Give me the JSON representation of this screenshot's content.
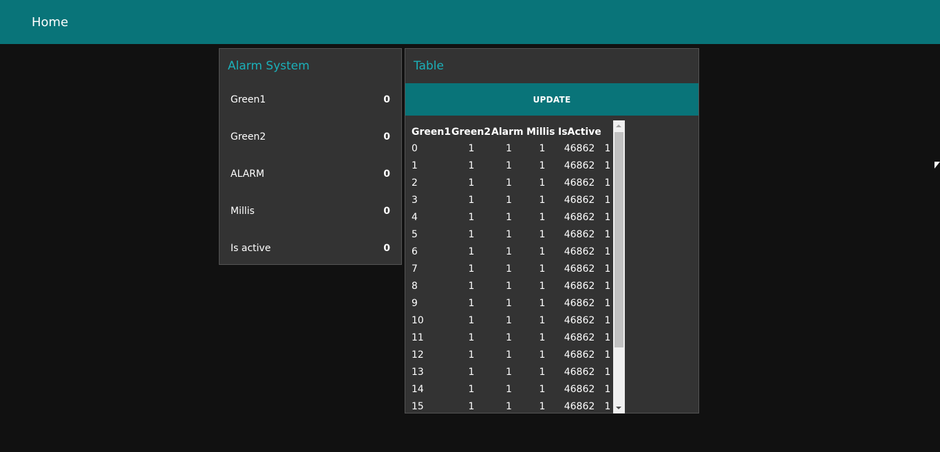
{
  "header": {
    "title": "Home"
  },
  "alarm_card": {
    "title": "Alarm System",
    "items": [
      {
        "label": "Green1",
        "value": "0"
      },
      {
        "label": "Green2",
        "value": "0"
      },
      {
        "label": "ALARM",
        "value": "0"
      },
      {
        "label": "Millis",
        "value": "0"
      },
      {
        "label": "Is active",
        "value": "0"
      }
    ]
  },
  "table_card": {
    "title": "Table",
    "update_label": "UPDATE",
    "columns": [
      "Green1",
      "Green2",
      "Alarm",
      "Millis",
      "IsActive"
    ],
    "rows": [
      [
        "0",
        "1",
        "1",
        "1",
        "46862",
        "1"
      ],
      [
        "1",
        "1",
        "1",
        "1",
        "46862",
        "1"
      ],
      [
        "2",
        "1",
        "1",
        "1",
        "46862",
        "1"
      ],
      [
        "3",
        "1",
        "1",
        "1",
        "46862",
        "1"
      ],
      [
        "4",
        "1",
        "1",
        "1",
        "46862",
        "1"
      ],
      [
        "5",
        "1",
        "1",
        "1",
        "46862",
        "1"
      ],
      [
        "6",
        "1",
        "1",
        "1",
        "46862",
        "1"
      ],
      [
        "7",
        "1",
        "1",
        "1",
        "46862",
        "1"
      ],
      [
        "8",
        "1",
        "1",
        "1",
        "46862",
        "1"
      ],
      [
        "9",
        "1",
        "1",
        "1",
        "46862",
        "1"
      ],
      [
        "10",
        "1",
        "1",
        "1",
        "46862",
        "1"
      ],
      [
        "11",
        "1",
        "1",
        "1",
        "46862",
        "1"
      ],
      [
        "12",
        "1",
        "1",
        "1",
        "46862",
        "1"
      ],
      [
        "13",
        "1",
        "1",
        "1",
        "46862",
        "1"
      ],
      [
        "14",
        "1",
        "1",
        "1",
        "46862",
        "1"
      ],
      [
        "15",
        "1",
        "1",
        "1",
        "46862",
        "1"
      ]
    ]
  },
  "colors": {
    "accent": "#097479",
    "title_text": "#1bb0b9",
    "card_bg": "#333333",
    "page_bg": "#111111"
  }
}
